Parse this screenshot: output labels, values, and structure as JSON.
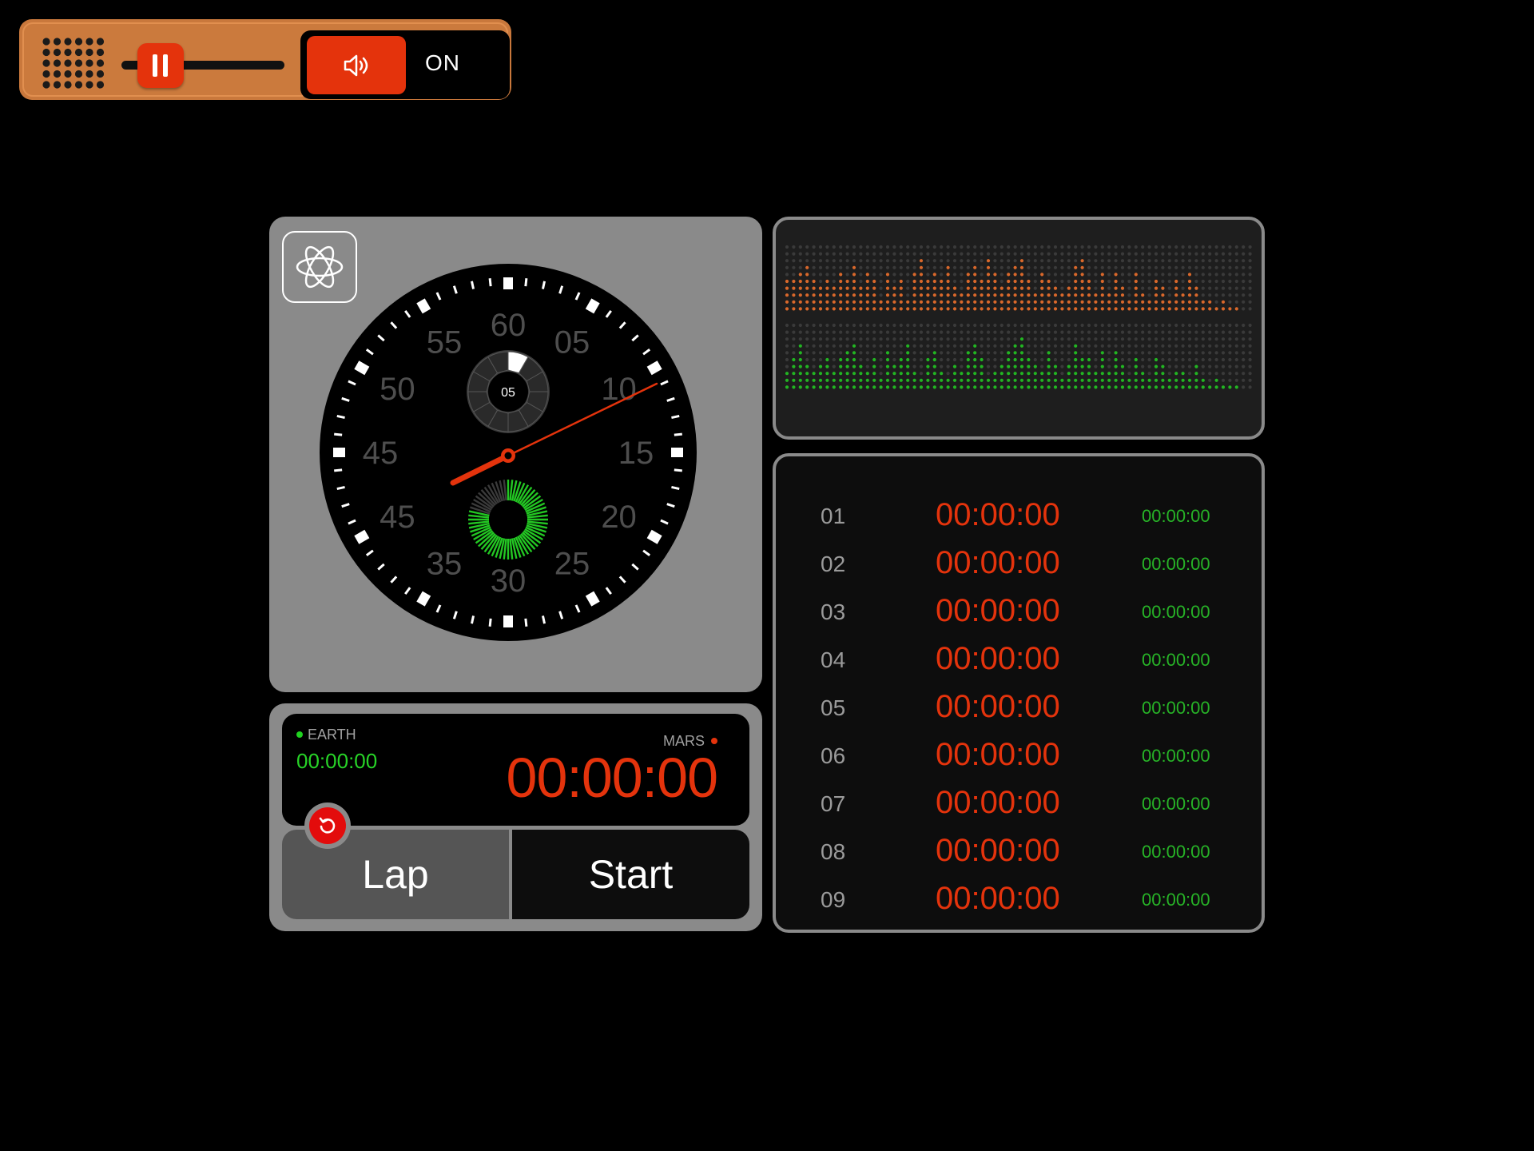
{
  "topbar": {
    "sound_state": "ON",
    "slider_level": 0.2,
    "accent_color": "#e4330c",
    "bar_color": "#c9783c",
    "icons": [
      "speaker-grille-icon",
      "pause-icon",
      "volume-icon"
    ]
  },
  "clock": {
    "outer_numbers": [
      "60",
      "05",
      "10",
      "15",
      "20",
      "25",
      "30",
      "35",
      "45",
      "45",
      "50",
      "55"
    ],
    "subdial_value": "05",
    "hand_color": "#e4330c"
  },
  "timer": {
    "earth_label": "EARTH",
    "earth_time": "00:00:00",
    "mars_label": "MARS",
    "mars_time": "00:00:00",
    "lap_label": "Lap",
    "start_label": "Start",
    "earth_color": "#27d327",
    "mars_color": "#e4330c"
  },
  "laps": [
    {
      "num": "01",
      "main": "00:00:00",
      "sub": "00:00:00"
    },
    {
      "num": "02",
      "main": "00:00:00",
      "sub": "00:00:00"
    },
    {
      "num": "03",
      "main": "00:00:00",
      "sub": "00:00:00"
    },
    {
      "num": "04",
      "main": "00:00:00",
      "sub": "00:00:00"
    },
    {
      "num": "05",
      "main": "00:00:00",
      "sub": "00:00:00"
    },
    {
      "num": "06",
      "main": "00:00:00",
      "sub": "00:00:00"
    },
    {
      "num": "07",
      "main": "00:00:00",
      "sub": "00:00:00"
    },
    {
      "num": "08",
      "main": "00:00:00",
      "sub": "00:00:00"
    },
    {
      "num": "09",
      "main": "00:00:00",
      "sub": "00:00:00"
    }
  ]
}
